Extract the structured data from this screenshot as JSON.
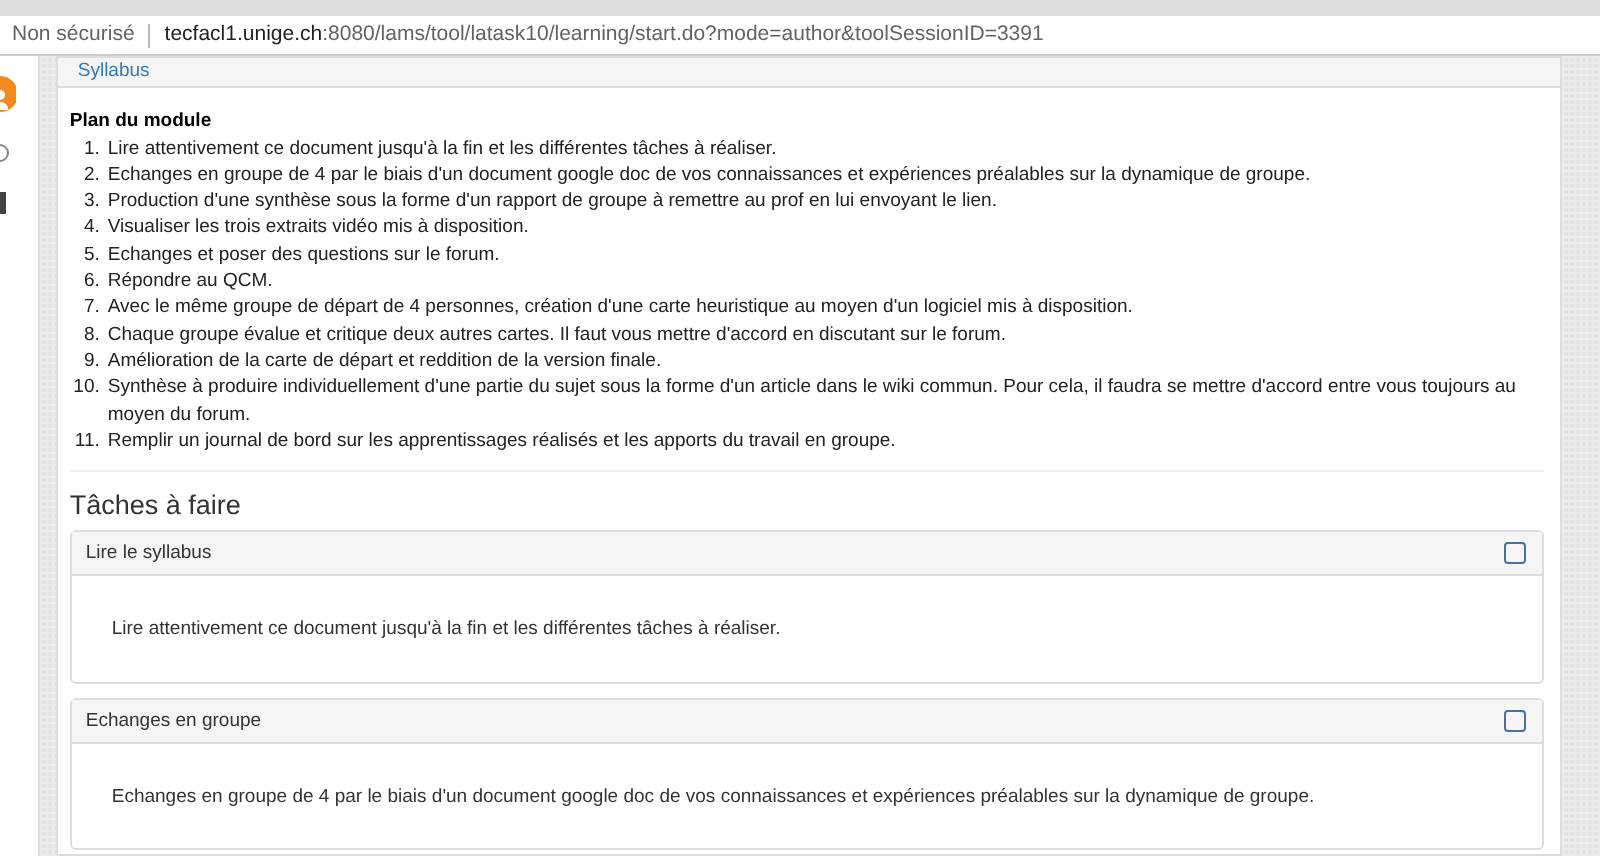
{
  "address_bar": {
    "security_label": "Non sécurisé",
    "url_host": "tecfacl1.unige.ch",
    "url_path": ":8080/lams/tool/latask10/learning/start.do?mode=author&toolSessionID=3391"
  },
  "panel": {
    "title": "Syllabus"
  },
  "plan": {
    "title": "Plan du module",
    "items": [
      {
        "number": "1.",
        "text": "Lire attentivement ce document jusqu'à la fin et les différentes tâches à réaliser."
      },
      {
        "number": "2.",
        "text": "Echanges en groupe de 4 par le biais d'un document google doc de vos connaissances et expériences préalables sur la dynamique de groupe."
      },
      {
        "number": "3.",
        "text": "Production d'une synthèse sous la forme d'un rapport de groupe à remettre au prof en lui envoyant le lien."
      },
      {
        "number": "4.",
        "text": "Visualiser les trois extraits vidéo mis à disposition."
      },
      {
        "number": "5.",
        "text": "Echanges et poser des questions sur le forum."
      },
      {
        "number": "6.",
        "text": "Répondre au QCM."
      },
      {
        "number": "7.",
        "text": "Avec le même groupe de départ de 4 personnes, création d'une carte heuristique au moyen d'un logiciel mis à disposition."
      },
      {
        "number": "8.",
        "text": "Chaque groupe évalue et critique deux autres cartes. Il faut vous mettre d'accord en discutant sur le forum."
      },
      {
        "number": "9.",
        "text": "Amélioration de la carte de départ et reddition de la version finale."
      },
      {
        "number": "10.",
        "text": "Synthèse à produire individuellement d'une partie du sujet sous la forme d'un article dans le wiki commun. Pour cela, il faudra se mettre d'accord entre vous toujours au moyen du forum."
      },
      {
        "number": "11.",
        "text": "Remplir un journal de bord sur les apprentissages réalisés et les apports du travail en groupe."
      }
    ]
  },
  "tasks": {
    "heading": "Tâches à faire",
    "items": [
      {
        "title": "Lire le syllabus",
        "checked": false,
        "description": "Lire attentivement ce document jusqu'à la fin et les différentes tâches à réaliser."
      },
      {
        "title": "Echanges en groupe",
        "checked": false,
        "description": "Echanges en groupe de 4 par le biais d'un document google doc de vos connaissances et expériences préalables sur la dynamique de groupe."
      }
    ]
  }
}
